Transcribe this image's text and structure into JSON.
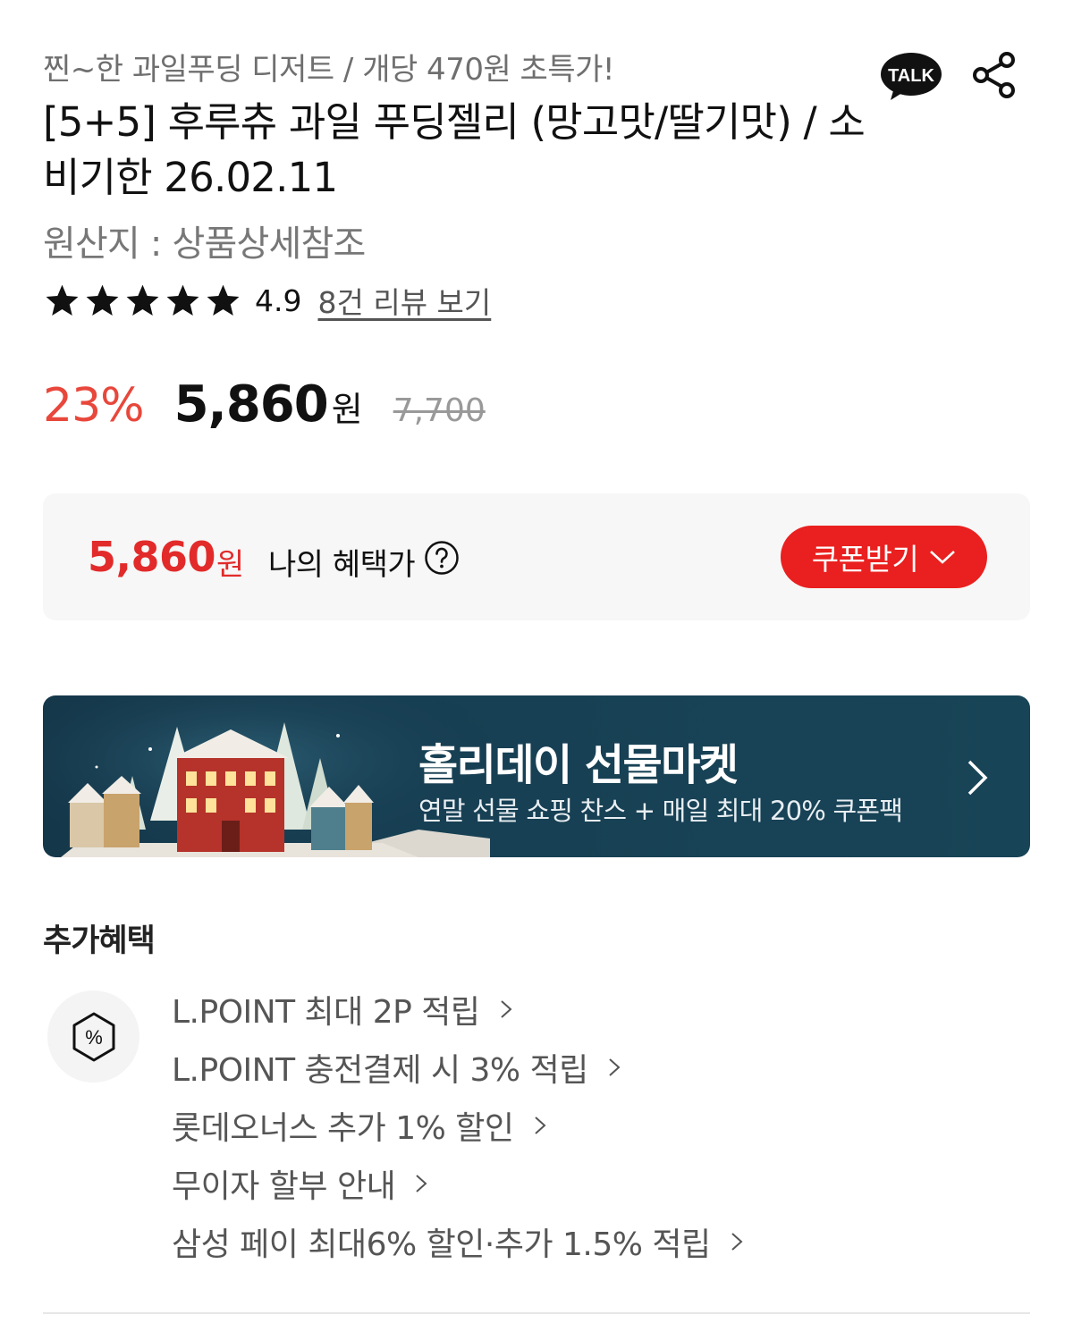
{
  "header": {
    "subtitle": "찐~한 과일푸딩 디저트 / 개당 470원 초특가!",
    "title": "[5+5] 후루츄 과일 푸딩젤리 (망고맛/딸기맛) / 소비기한 26.02.11",
    "origin": "원산지 : 상품상세참조",
    "talk_label": "TALK"
  },
  "rating": {
    "stars": 5,
    "score": "4.9",
    "review_link": "8건 리뷰 보기"
  },
  "price": {
    "discount": "23%",
    "sale_price": "5,860",
    "won": "원",
    "original_price": "7,700"
  },
  "benefit_box": {
    "price": "5,860",
    "won": "원",
    "label": "나의 혜택가",
    "coupon_button": "쿠폰받기"
  },
  "banner": {
    "title": "홀리데이 선물마켓",
    "subtitle": "연말 선물 쇼핑 찬스 + 매일 최대 20% 쿠폰팩"
  },
  "extra_benefits": {
    "title": "추가혜택",
    "items": [
      "L.POINT 최대 2P 적립",
      "L.POINT 충전결제 시 3% 적립",
      "롯데오너스 추가 1% 할인",
      "무이자 할부 안내",
      "삼성 페이 최대6% 할인·추가 1.5% 적립"
    ]
  },
  "colors": {
    "accent_red": "#e9201f",
    "discount_red": "#e8473b",
    "banner_bg": "#173f53"
  },
  "icons": [
    "kakao-talk-icon",
    "share-icon",
    "star-icon",
    "help-icon",
    "chevron-down-icon",
    "chevron-right-icon",
    "percent-coupon-icon"
  ]
}
